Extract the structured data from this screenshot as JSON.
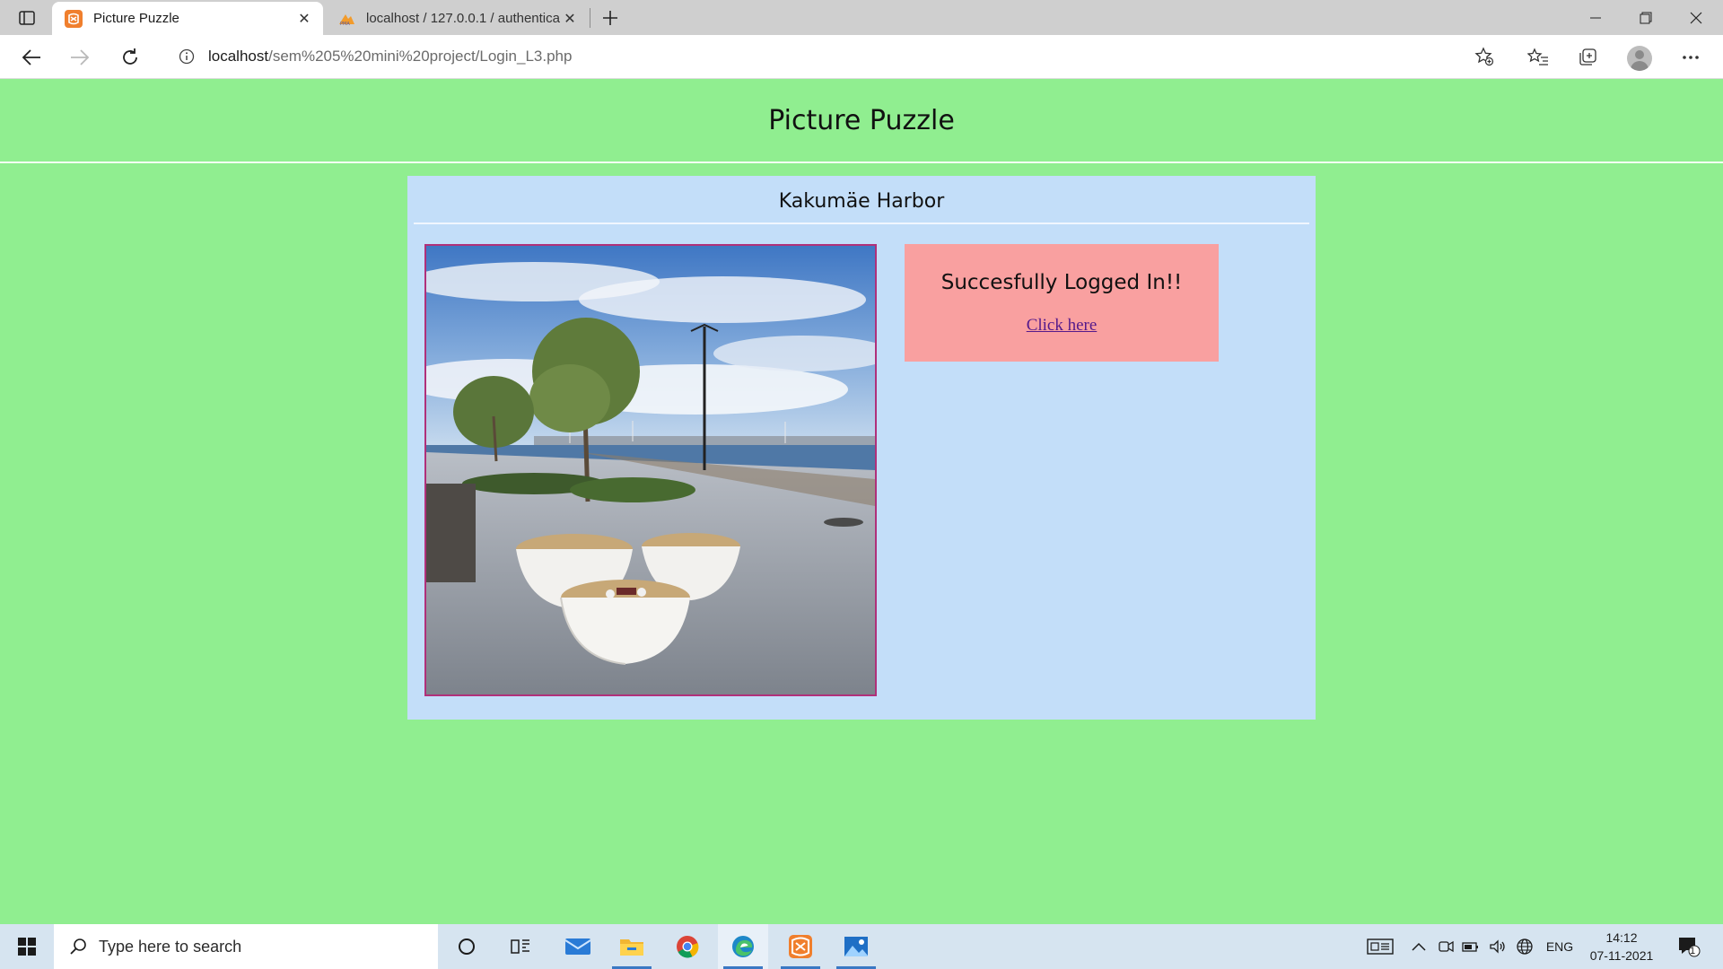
{
  "browser": {
    "tabs": [
      {
        "title": "Picture Puzzle",
        "active": true,
        "favicon": "xampp-icon"
      },
      {
        "title": "localhost / 127.0.0.1 / authentica",
        "active": false,
        "favicon": "phpmyadmin-icon"
      }
    ],
    "address": {
      "host": "localhost",
      "path": "/sem%205%20mini%20project/Login_L3.php"
    }
  },
  "page": {
    "title": "Picture Puzzle",
    "card": {
      "title": "Kakumäe Harbor",
      "image_alt": "Harbor promenade with bowl-shaped benches, trees and marina",
      "message": "Succesfully Logged In!!",
      "link_label": "Click here"
    }
  },
  "taskbar": {
    "search_placeholder": "Type here to search",
    "language": "ENG",
    "time": "14:12",
    "date": "07-11-2021",
    "notification_count": "1",
    "pinned": [
      "task-view",
      "widgets",
      "mail",
      "file-explorer",
      "chrome",
      "edge",
      "xampp",
      "photos"
    ]
  },
  "colors": {
    "page_bg": "#90EE90",
    "card_bg": "#C3DEF9",
    "message_bg": "#F9A0A0",
    "link": "#551A8B",
    "image_border": "#b0307a"
  }
}
